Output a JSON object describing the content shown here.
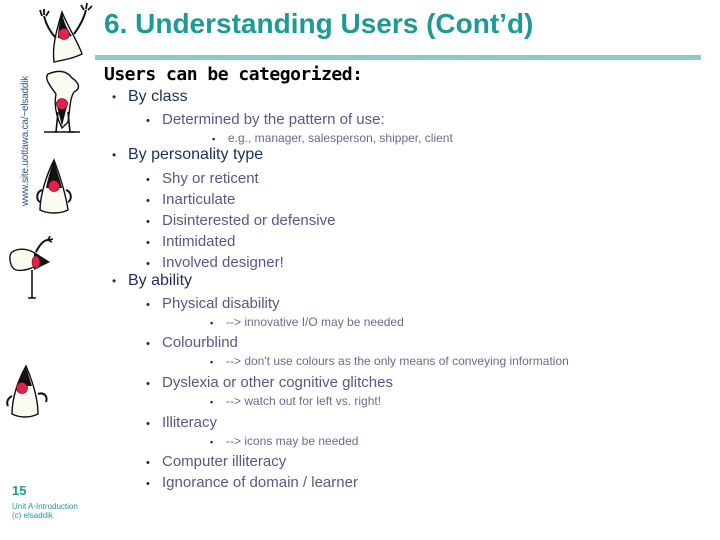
{
  "sidebar": {
    "url": "www.site.uottawa.ca/~elsaddik",
    "mascots": [
      "duke-mascot-icon",
      "duke-mascot-icon",
      "duke-mascot-icon",
      "duke-mascot-icon",
      "duke-mascot-icon",
      "duke-mascot-icon"
    ]
  },
  "header": {
    "title": "6. Understanding Users (Cont’d)"
  },
  "content": {
    "intro": "Users can be categorized:",
    "sections": [
      {
        "label": "By class",
        "items": [
          {
            "label": "Determined by the pattern of use:",
            "notes": [
              "e.g., manager, salesperson, shipper, client"
            ]
          }
        ]
      },
      {
        "label": "By personality type",
        "items": [
          {
            "label": "Shy or reticent"
          },
          {
            "label": "Inarticulate"
          },
          {
            "label": "Disinterested or defensive"
          },
          {
            "label": "Intimidated"
          },
          {
            "label": "Involved designer!"
          }
        ]
      },
      {
        "label": "By ability",
        "items": [
          {
            "label": "Physical disability",
            "notes": [
              "--> innovative I/O may be needed"
            ]
          },
          {
            "label": "Colourblind",
            "notes": [
              "--> don't use colours as the only means of conveying information"
            ]
          },
          {
            "label": "Dyslexia or other cognitive glitches",
            "notes": [
              "--> watch out for left vs. right!"
            ]
          },
          {
            "label": "Illiteracy",
            "notes": [
              "--> icons may be needed"
            ]
          },
          {
            "label": "Computer illiteracy"
          },
          {
            "label": "Ignorance of domain / learner"
          }
        ]
      }
    ]
  },
  "footer": {
    "slide_number": "15",
    "course": "Unit A-Introduction",
    "copyright": "(c) elsaddik"
  },
  "colors": {
    "title": "#1e9a95",
    "rule": "#85cccc",
    "level1": "#1c2f5c",
    "level2": "#5d5585",
    "level3": "#6c6a8c"
  }
}
